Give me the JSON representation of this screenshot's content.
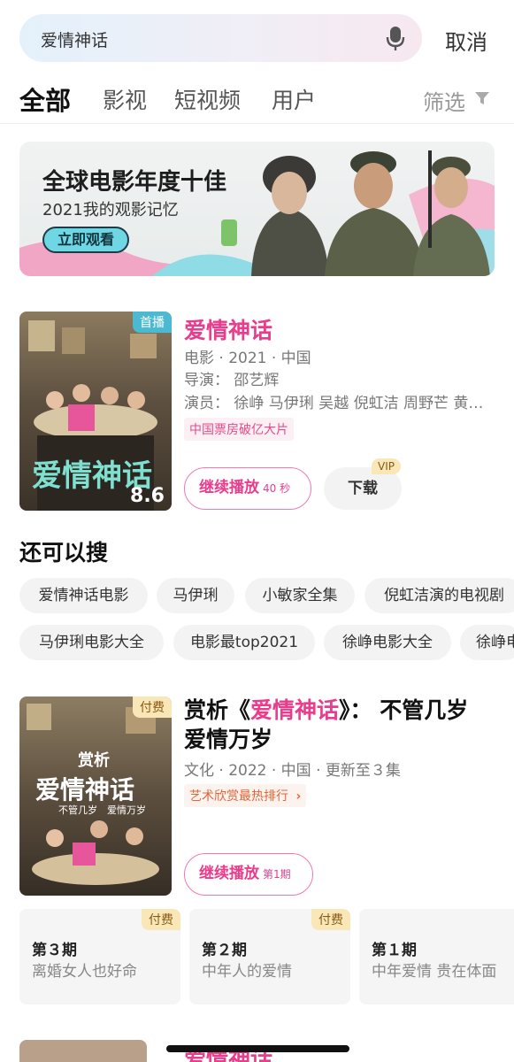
{
  "search": {
    "query": "爱情神话",
    "cancel_label": "取消"
  },
  "tabs": [
    {
      "label": "全部",
      "active": true
    },
    {
      "label": "影视"
    },
    {
      "label": "短视频"
    },
    {
      "label": "用户"
    }
  ],
  "filter_label": "筛选",
  "banner": {
    "title": "全球电影年度十佳",
    "subtitle": "2021我的观影记忆",
    "button_label": "立即观看"
  },
  "movie": {
    "title": "爱情神话",
    "badge": "首播",
    "score": "8.6",
    "poster_title": "爱情神话",
    "meta": "电影 · 2021 · 中国",
    "director": "导演：  邵艺辉",
    "cast": "演员：  徐峥 马伊琍 吴越 倪虹洁 周野芒 黄…",
    "tag": "中国票房破亿大片",
    "play_label": "继续播放",
    "play_progress": "40 秒",
    "download_label": "下载",
    "vip_label": "VIP"
  },
  "suggest": {
    "title": "还可以搜",
    "row1": [
      "爱情神话电影",
      "马伊琍",
      "小敏家全集",
      "倪虹洁演的电视剧"
    ],
    "row2": [
      "马伊琍电影大全",
      "电影最top2021",
      "徐峥电影大全",
      "徐峥电"
    ]
  },
  "show": {
    "badge": "付费",
    "poster_top": "赏析",
    "poster_title": "爱情神话",
    "poster_sub": "不管几岁　爱情万岁",
    "title_prefix": "赏析《",
    "title_highlight": "爱情神话",
    "title_suffix": "》：  不管几岁 爱情万岁",
    "meta": "文化 · 2022 · 中国 · 更新至３集",
    "rank": "艺术欣赏最热排行",
    "play_label": "继续播放",
    "play_progress": "第1期",
    "episodes": [
      {
        "num": "第３期",
        "desc": "离婚女人也好命",
        "badge": "付费"
      },
      {
        "num": "第２期",
        "desc": "中年人的爱情",
        "badge": "付费"
      },
      {
        "num": "第１期",
        "desc": "中年爱情 贵在体面",
        "badge": ""
      }
    ]
  },
  "peek": {
    "title": "爱情神话"
  }
}
